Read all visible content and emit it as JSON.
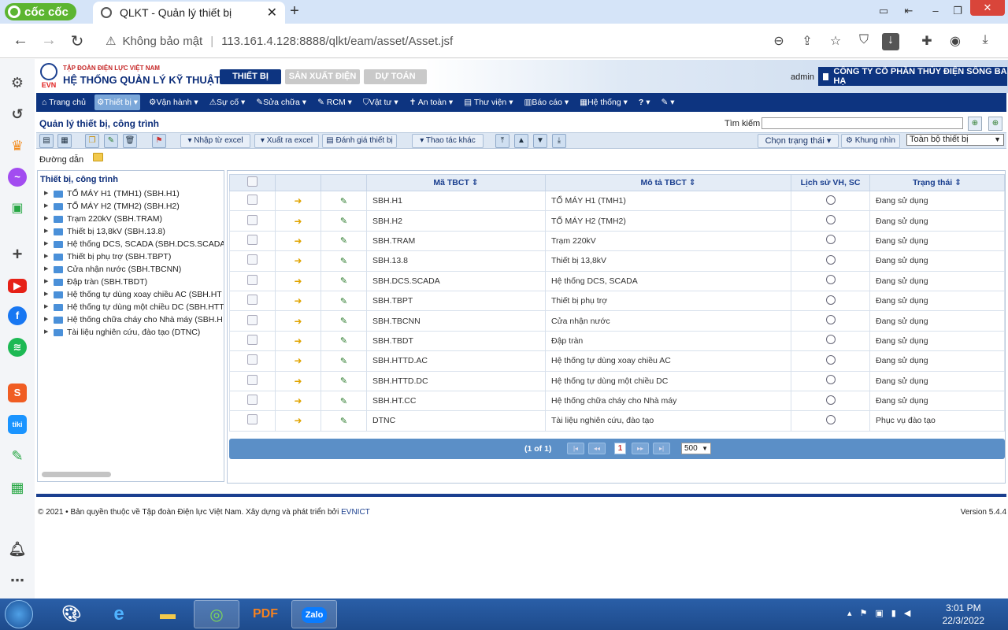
{
  "browser": {
    "brand": "cốc cốc",
    "tab_title": "QLKT - Quản lý thiết bị",
    "security": "Không bảo mật",
    "url": "113.161.4.128:8888/qlkt/eam/asset/Asset.jsf"
  },
  "header": {
    "corp_name": "TẬP ĐOÀN ĐIỆN LỰC VIỆT NAM",
    "system_name": "HỆ THỐNG QUẢN LÝ KỸ THUẬT",
    "logo_text": "EVN",
    "tabs": [
      "THIẾT BỊ",
      "SẢN XUẤT ĐIỆN",
      "DỰ TOÁN"
    ],
    "user": "admin",
    "company": "CÔNG TY CỔ PHẦN THỦY ĐIỆN SÔNG BA HẠ"
  },
  "menu": [
    "Trang chủ",
    "Thiết bị",
    "Vận hành",
    "Sự cố",
    "Sửa chữa",
    "RCM",
    "Vật tư",
    "An toàn",
    "Thư viện",
    "Báo cáo",
    "Hệ thống",
    "?"
  ],
  "page": {
    "title": "Quản lý thiết bị, công trình",
    "search_label": "Tìm kiếm",
    "path_label": "Đường dẫn"
  },
  "toolbar": {
    "import_excel": "Nhập từ excel",
    "export_excel": "Xuất ra excel",
    "evaluate": "Đánh giá thiết bị",
    "other_actions": "Thao tác khác",
    "choose_status": "Chọn trạng thái",
    "view_frame": "Khung nhìn",
    "view_select": "Toàn bộ thiết bị"
  },
  "tree": {
    "title": "Thiết bị, công trình",
    "nodes": [
      "TỔ MÁY H1 (TMH1) (SBH.H1)",
      "TỔ MÁY H2 (TMH2) (SBH.H2)",
      "Trạm 220kV (SBH.TRAM)",
      "Thiết bị 13,8kV (SBH.13.8)",
      "Hệ thống DCS, SCADA (SBH.DCS.SCADA)",
      "Thiết bị phụ trợ (SBH.TBPT)",
      "Cửa nhận nước (SBH.TBCNN)",
      "Đập tràn (SBH.TBDT)",
      "Hệ thống tự dùng xoay chiều AC (SBH.HT",
      "Hệ thống tự dùng một chiều DC (SBH.HTT",
      "Hệ thống chữa cháy cho Nhà máy (SBH.H",
      "Tài liệu nghiên cứu, đào tạo (DTNC)"
    ]
  },
  "grid": {
    "columns": [
      "Mã TBCT",
      "Mô tả TBCT",
      "Lịch sử VH, SC",
      "Trạng thái"
    ],
    "rows": [
      {
        "code": "SBH.H1",
        "desc": "TỔ MÁY H1 (TMH1)",
        "status": "Đang sử dụng"
      },
      {
        "code": "SBH.H2",
        "desc": "TỔ MÁY H2 (TMH2)",
        "status": "Đang sử dụng"
      },
      {
        "code": "SBH.TRAM",
        "desc": "Trạm 220kV",
        "status": "Đang sử dụng"
      },
      {
        "code": "SBH.13.8",
        "desc": "Thiết bị 13,8kV",
        "status": "Đang sử dụng"
      },
      {
        "code": "SBH.DCS.SCADA",
        "desc": "Hệ thống DCS, SCADA",
        "status": "Đang sử dụng"
      },
      {
        "code": "SBH.TBPT",
        "desc": "Thiết bị phụ trợ",
        "status": "Đang sử dụng"
      },
      {
        "code": "SBH.TBCNN",
        "desc": "Cửa nhận nước",
        "status": "Đang sử dụng"
      },
      {
        "code": "SBH.TBDT",
        "desc": "Đập tràn",
        "status": "Đang sử dụng"
      },
      {
        "code": "SBH.HTTD.AC",
        "desc": "Hệ thống tự dùng xoay chiều AC",
        "status": "Đang sử dụng"
      },
      {
        "code": "SBH.HTTD.DC",
        "desc": "Hệ thống tự dùng một chiều DC",
        "status": "Đang sử dụng"
      },
      {
        "code": "SBH.HT.CC",
        "desc": "Hệ thống chữa cháy cho Nhà máy",
        "status": "Đang sử dụng"
      },
      {
        "code": "DTNC",
        "desc": "Tài liệu nghiên cứu, đào tạo",
        "status": "Phục vụ đào tạo"
      }
    ],
    "pager_info": "(1 of 1)",
    "current_page": "1",
    "page_size": "500"
  },
  "footer": {
    "copyright": "©  2021  •  Bản quyền thuộc về Tập đoàn Điện lực Việt Nam. Xây dựng và phát triển bởi ",
    "developer": "EVNICT",
    "version": "Version 5.4.4"
  },
  "taskbar": {
    "time": "3:01 PM",
    "date": "22/3/2022",
    "zalo": "Zalo"
  }
}
